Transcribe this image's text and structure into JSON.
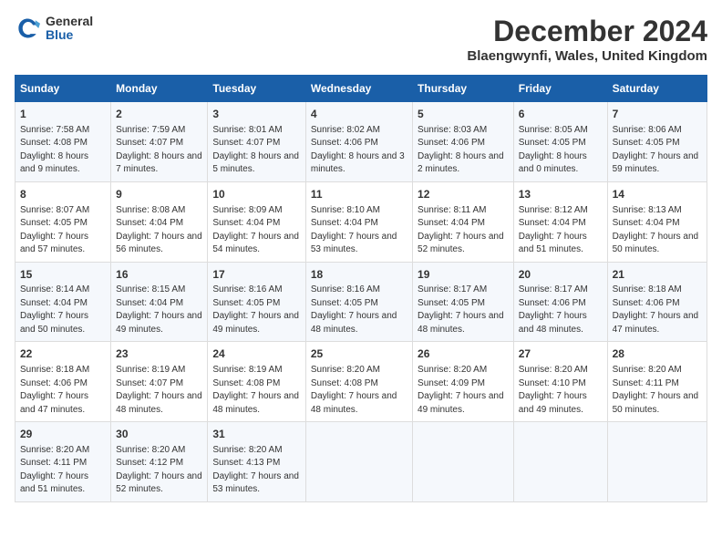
{
  "header": {
    "logo_general": "General",
    "logo_blue": "Blue",
    "month_title": "December 2024",
    "location": "Blaengwynfi, Wales, United Kingdom"
  },
  "columns": [
    "Sunday",
    "Monday",
    "Tuesday",
    "Wednesday",
    "Thursday",
    "Friday",
    "Saturday"
  ],
  "rows": [
    [
      {
        "day": "1",
        "rise": "Sunrise: 7:58 AM",
        "set": "Sunset: 4:08 PM",
        "daylight": "Daylight: 8 hours and 9 minutes."
      },
      {
        "day": "2",
        "rise": "Sunrise: 7:59 AM",
        "set": "Sunset: 4:07 PM",
        "daylight": "Daylight: 8 hours and 7 minutes."
      },
      {
        "day": "3",
        "rise": "Sunrise: 8:01 AM",
        "set": "Sunset: 4:07 PM",
        "daylight": "Daylight: 8 hours and 5 minutes."
      },
      {
        "day": "4",
        "rise": "Sunrise: 8:02 AM",
        "set": "Sunset: 4:06 PM",
        "daylight": "Daylight: 8 hours and 3 minutes."
      },
      {
        "day": "5",
        "rise": "Sunrise: 8:03 AM",
        "set": "Sunset: 4:06 PM",
        "daylight": "Daylight: 8 hours and 2 minutes."
      },
      {
        "day": "6",
        "rise": "Sunrise: 8:05 AM",
        "set": "Sunset: 4:05 PM",
        "daylight": "Daylight: 8 hours and 0 minutes."
      },
      {
        "day": "7",
        "rise": "Sunrise: 8:06 AM",
        "set": "Sunset: 4:05 PM",
        "daylight": "Daylight: 7 hours and 59 minutes."
      }
    ],
    [
      {
        "day": "8",
        "rise": "Sunrise: 8:07 AM",
        "set": "Sunset: 4:05 PM",
        "daylight": "Daylight: 7 hours and 57 minutes."
      },
      {
        "day": "9",
        "rise": "Sunrise: 8:08 AM",
        "set": "Sunset: 4:04 PM",
        "daylight": "Daylight: 7 hours and 56 minutes."
      },
      {
        "day": "10",
        "rise": "Sunrise: 8:09 AM",
        "set": "Sunset: 4:04 PM",
        "daylight": "Daylight: 7 hours and 54 minutes."
      },
      {
        "day": "11",
        "rise": "Sunrise: 8:10 AM",
        "set": "Sunset: 4:04 PM",
        "daylight": "Daylight: 7 hours and 53 minutes."
      },
      {
        "day": "12",
        "rise": "Sunrise: 8:11 AM",
        "set": "Sunset: 4:04 PM",
        "daylight": "Daylight: 7 hours and 52 minutes."
      },
      {
        "day": "13",
        "rise": "Sunrise: 8:12 AM",
        "set": "Sunset: 4:04 PM",
        "daylight": "Daylight: 7 hours and 51 minutes."
      },
      {
        "day": "14",
        "rise": "Sunrise: 8:13 AM",
        "set": "Sunset: 4:04 PM",
        "daylight": "Daylight: 7 hours and 50 minutes."
      }
    ],
    [
      {
        "day": "15",
        "rise": "Sunrise: 8:14 AM",
        "set": "Sunset: 4:04 PM",
        "daylight": "Daylight: 7 hours and 50 minutes."
      },
      {
        "day": "16",
        "rise": "Sunrise: 8:15 AM",
        "set": "Sunset: 4:04 PM",
        "daylight": "Daylight: 7 hours and 49 minutes."
      },
      {
        "day": "17",
        "rise": "Sunrise: 8:16 AM",
        "set": "Sunset: 4:05 PM",
        "daylight": "Daylight: 7 hours and 49 minutes."
      },
      {
        "day": "18",
        "rise": "Sunrise: 8:16 AM",
        "set": "Sunset: 4:05 PM",
        "daylight": "Daylight: 7 hours and 48 minutes."
      },
      {
        "day": "19",
        "rise": "Sunrise: 8:17 AM",
        "set": "Sunset: 4:05 PM",
        "daylight": "Daylight: 7 hours and 48 minutes."
      },
      {
        "day": "20",
        "rise": "Sunrise: 8:17 AM",
        "set": "Sunset: 4:06 PM",
        "daylight": "Daylight: 7 hours and 48 minutes."
      },
      {
        "day": "21",
        "rise": "Sunrise: 8:18 AM",
        "set": "Sunset: 4:06 PM",
        "daylight": "Daylight: 7 hours and 47 minutes."
      }
    ],
    [
      {
        "day": "22",
        "rise": "Sunrise: 8:18 AM",
        "set": "Sunset: 4:06 PM",
        "daylight": "Daylight: 7 hours and 47 minutes."
      },
      {
        "day": "23",
        "rise": "Sunrise: 8:19 AM",
        "set": "Sunset: 4:07 PM",
        "daylight": "Daylight: 7 hours and 48 minutes."
      },
      {
        "day": "24",
        "rise": "Sunrise: 8:19 AM",
        "set": "Sunset: 4:08 PM",
        "daylight": "Daylight: 7 hours and 48 minutes."
      },
      {
        "day": "25",
        "rise": "Sunrise: 8:20 AM",
        "set": "Sunset: 4:08 PM",
        "daylight": "Daylight: 7 hours and 48 minutes."
      },
      {
        "day": "26",
        "rise": "Sunrise: 8:20 AM",
        "set": "Sunset: 4:09 PM",
        "daylight": "Daylight: 7 hours and 49 minutes."
      },
      {
        "day": "27",
        "rise": "Sunrise: 8:20 AM",
        "set": "Sunset: 4:10 PM",
        "daylight": "Daylight: 7 hours and 49 minutes."
      },
      {
        "day": "28",
        "rise": "Sunrise: 8:20 AM",
        "set": "Sunset: 4:11 PM",
        "daylight": "Daylight: 7 hours and 50 minutes."
      }
    ],
    [
      {
        "day": "29",
        "rise": "Sunrise: 8:20 AM",
        "set": "Sunset: 4:11 PM",
        "daylight": "Daylight: 7 hours and 51 minutes."
      },
      {
        "day": "30",
        "rise": "Sunrise: 8:20 AM",
        "set": "Sunset: 4:12 PM",
        "daylight": "Daylight: 7 hours and 52 minutes."
      },
      {
        "day": "31",
        "rise": "Sunrise: 8:20 AM",
        "set": "Sunset: 4:13 PM",
        "daylight": "Daylight: 7 hours and 53 minutes."
      },
      null,
      null,
      null,
      null
    ]
  ]
}
